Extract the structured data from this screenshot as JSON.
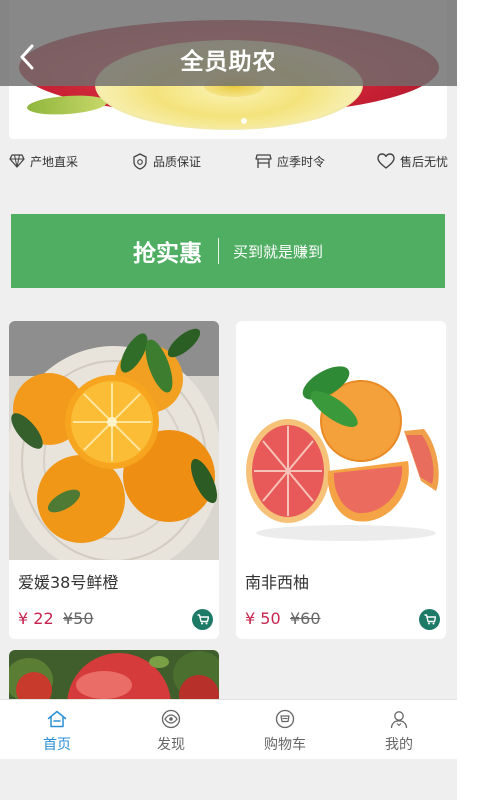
{
  "header": {
    "title": "全员助农",
    "back_icon": "chevron-left-icon"
  },
  "banner": {
    "image": "apple-banner-photo",
    "active_slide": 1
  },
  "features": [
    {
      "label": "产地直采",
      "icon": "diamond-icon"
    },
    {
      "label": "品质保证",
      "icon": "quality-shield-icon"
    },
    {
      "label": "应季时令",
      "icon": "shop-icon"
    },
    {
      "label": "售后无忧",
      "icon": "heart-icon"
    }
  ],
  "promo": {
    "title": "抢实惠",
    "subtitle": "买到就是赚到",
    "color": "#50ae63"
  },
  "products": [
    {
      "name": "爱媛38号鲜橙",
      "price": "¥ 22",
      "old_price": "¥50",
      "image": "orange-photo"
    },
    {
      "name": "南非西柚",
      "price": "¥ 50",
      "old_price": "¥60",
      "image": "grapefruit-photo"
    },
    {
      "name": "",
      "price": "",
      "old_price": "",
      "image": "apple-photo"
    }
  ],
  "tabbar": {
    "items": [
      {
        "label": "首页",
        "icon": "home-icon",
        "active": true
      },
      {
        "label": "发现",
        "icon": "eye-icon",
        "active": false
      },
      {
        "label": "购物车",
        "icon": "cart-icon",
        "active": false
      },
      {
        "label": "我的",
        "icon": "user-icon",
        "active": false
      }
    ]
  },
  "colors": {
    "accent": "#2b8fd4",
    "price": "#c7254e",
    "cart_button": "#1c7a66",
    "promo": "#50ae63"
  }
}
